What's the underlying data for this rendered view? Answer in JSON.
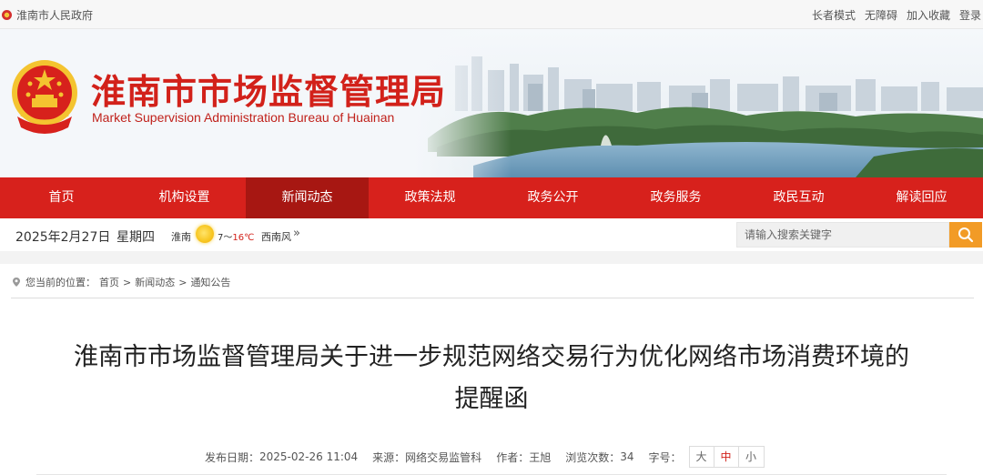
{
  "topbar": {
    "site_name": "淮南市人民政府",
    "links": [
      "长者模式",
      "无障碍",
      "加入收藏",
      "登录"
    ]
  },
  "banner": {
    "title_cn": "淮南市市场监督管理局",
    "title_en": "Market Supervision Administration Bureau of Huainan"
  },
  "nav": {
    "items": [
      "首页",
      "机构设置",
      "新闻动态",
      "政策法规",
      "政务公开",
      "政务服务",
      "政民互动",
      "解读回应"
    ],
    "active": "新闻动态"
  },
  "info": {
    "date": "2025年2月27日",
    "weekday": "星期四",
    "city": "淮南",
    "temp_low": "7～",
    "temp_high": "16℃",
    "wind": "西南风",
    "search_placeholder": "请输入搜索关键字"
  },
  "breadcrumb": {
    "prefix": "您当前的位置：",
    "items": [
      "首页",
      "新闻动态",
      "通知公告"
    ],
    "separator": ">"
  },
  "article": {
    "title_line1": "淮南市市场监督管理局关于进一步规范网络交易行为优化网络市场消费环境的",
    "title_line2": "提醒函",
    "publish_label": "发布日期：",
    "publish_date": "2025-02-26 11:04",
    "source_label": "来源：",
    "source": "网络交易监管科",
    "author_label": "作者：",
    "author": "王旭",
    "views_label": "浏览次数：",
    "views": "34",
    "fontsize_label": "字号：",
    "fontsizes": [
      "大",
      "中",
      "小"
    ],
    "fontsize_active": "中"
  },
  "colors": {
    "brand_red": "#d7211c",
    "nav_active": "#a71712",
    "search_button": "#f29b26"
  }
}
